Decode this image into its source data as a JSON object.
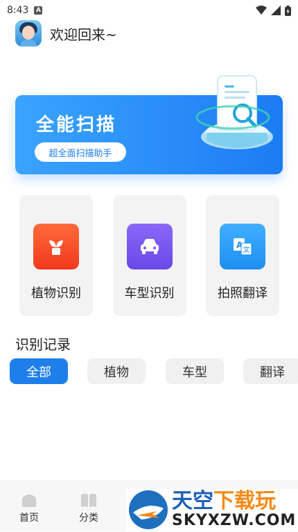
{
  "status": {
    "time": "8:43",
    "badge": "A"
  },
  "header": {
    "welcome": "欢迎回来~"
  },
  "banner": {
    "title": "全能扫描",
    "button": "超全面扫描助手"
  },
  "features": [
    {
      "label": "植物识别",
      "icon": "plant-icon",
      "color": "#ff5a2a"
    },
    {
      "label": "车型识别",
      "icon": "car-icon",
      "color": "#7b5cf0"
    },
    {
      "label": "拍照翻译",
      "icon": "translate-icon",
      "color": "#2ea1ff"
    }
  ],
  "records": {
    "title": "识别记录"
  },
  "tabs": [
    {
      "label": "全部",
      "active": true
    },
    {
      "label": "植物",
      "active": false
    },
    {
      "label": "车型",
      "active": false
    },
    {
      "label": "翻译",
      "active": false
    }
  ],
  "bottom_nav": [
    {
      "label": "首页",
      "icon": "home-icon"
    },
    {
      "label": "分类",
      "icon": "category-icon"
    }
  ],
  "watermark": {
    "line1_a": "天空",
    "line1_b": "下载玩",
    "line2": "SKYXZW.COM"
  }
}
